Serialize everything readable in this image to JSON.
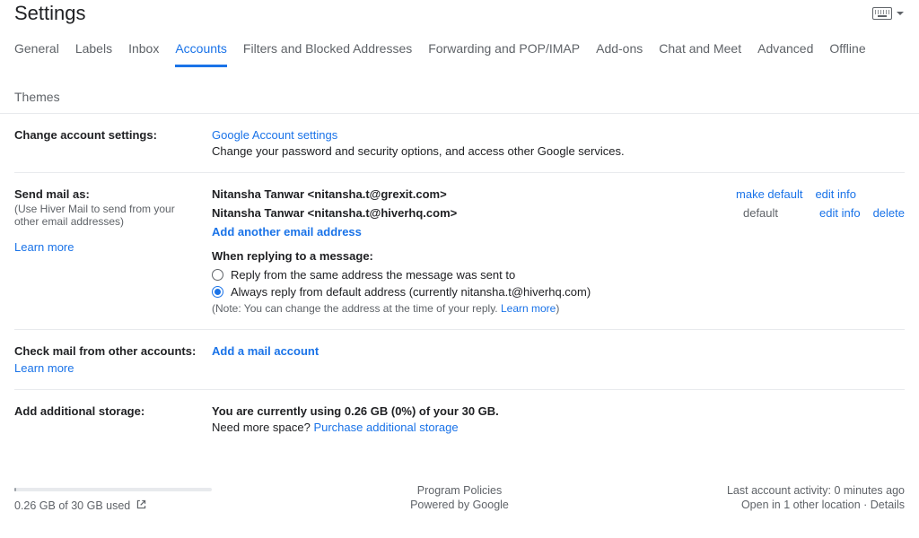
{
  "header": {
    "title": "Settings"
  },
  "tabs": {
    "general": "General",
    "labels": "Labels",
    "inbox": "Inbox",
    "accounts": "Accounts",
    "filters": "Filters and Blocked Addresses",
    "forwarding": "Forwarding and POP/IMAP",
    "addons": "Add-ons",
    "chat": "Chat and Meet",
    "advanced": "Advanced",
    "offline": "Offline",
    "themes": "Themes"
  },
  "change_account": {
    "label": "Change account settings:",
    "link": "Google Account settings",
    "desc": "Change your password and security options, and access other Google services."
  },
  "send_as": {
    "label": "Send mail as:",
    "sub": "(Use Hiver Mail to send from your other email addresses)",
    "learn_more": "Learn more",
    "rows": [
      {
        "display": "Nitansha Tanwar <nitansha.t@grexit.com>",
        "is_default": false,
        "make_default": "make default",
        "edit": "edit info",
        "delete": ""
      },
      {
        "display": "Nitansha Tanwar <nitansha.t@hiverhq.com>",
        "is_default": true,
        "default_label": "default",
        "edit": "edit info",
        "delete": "delete"
      }
    ],
    "add_another": "Add another email address",
    "reply_title": "When replying to a message:",
    "reply_opt1": "Reply from the same address the message was sent to",
    "reply_opt2": "Always reply from default address (currently nitansha.t@hiverhq.com)",
    "note_pre": "(Note: You can change the address at the time of your reply. ",
    "note_link": "Learn more",
    "note_post": ")"
  },
  "check_mail": {
    "label": "Check mail from other accounts:",
    "learn_more": "Learn more",
    "add": "Add a mail account"
  },
  "storage": {
    "label": "Add additional storage:",
    "line1": "You are currently using 0.26 GB (0%) of your 30 GB.",
    "line2_pre": "Need more space? ",
    "line2_link": "Purchase additional storage"
  },
  "footer": {
    "storage_used": "0.26 GB of 30 GB used",
    "policies": "Program Policies",
    "powered": "Powered by Google",
    "activity": "Last account activity: 0 minutes ago",
    "locations_pre": "Open in 1 other location · ",
    "details": "Details"
  }
}
